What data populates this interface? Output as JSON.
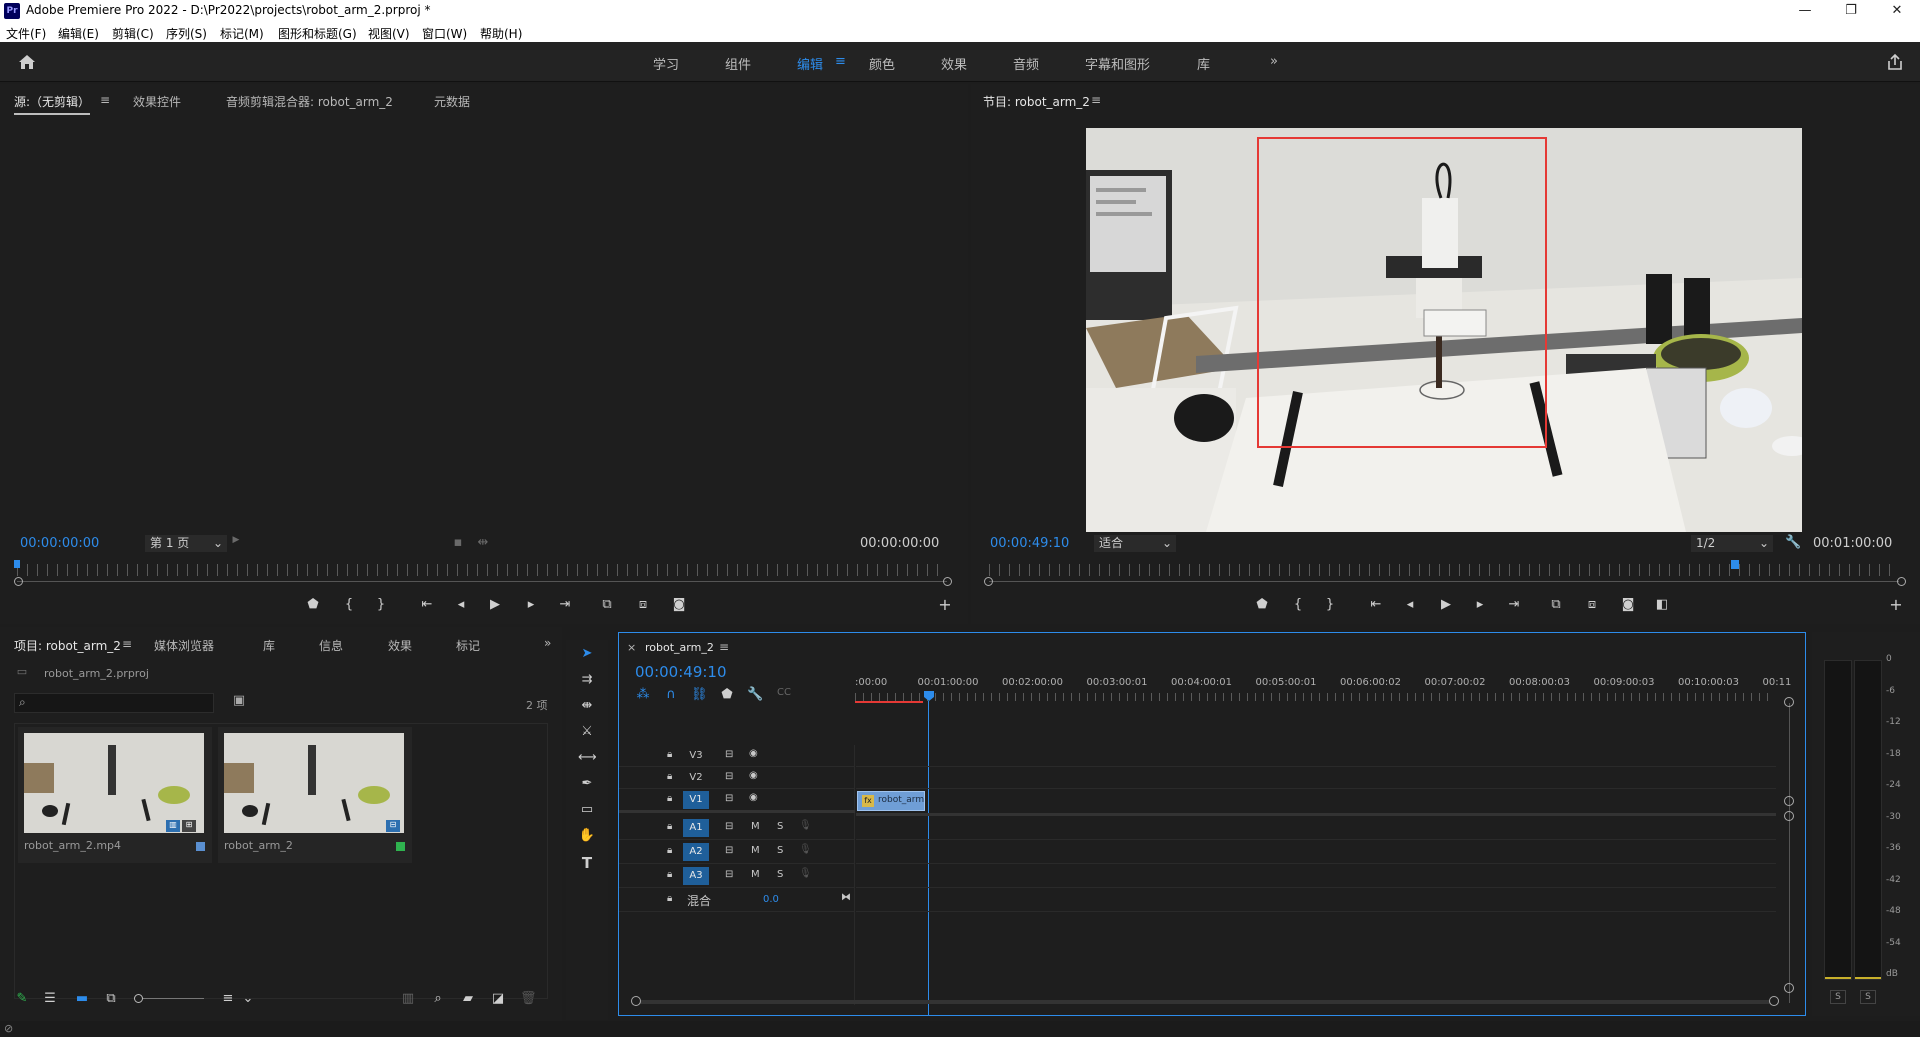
{
  "window": {
    "app_icon": "Pr",
    "title": "Adobe Premiere Pro 2022 - D:\\Pr2022\\projects\\robot_arm_2.prproj *",
    "minimize": "—",
    "restore": "❐",
    "close": "✕"
  },
  "menu": [
    "文件(F)",
    "编辑(E)",
    "剪辑(C)",
    "序列(S)",
    "标记(M)",
    "图形和标题(G)",
    "视图(V)",
    "窗口(W)",
    "帮助(H)"
  ],
  "workspaces": {
    "items": [
      "学习",
      "组件",
      "编辑",
      "颜色",
      "效果",
      "音频",
      "字幕和图形",
      "库"
    ],
    "active_index": 2,
    "more": "»"
  },
  "source_panel": {
    "tabs": [
      "源:（无剪辑）",
      "效果控件",
      "音频剪辑混合器: robot_arm_2",
      "元数据"
    ],
    "timecode_left": "00:00:00:00",
    "page_select": "第 1 页",
    "timecode_right": "00:00:00:00"
  },
  "program_panel": {
    "tab": "节目: robot_arm_2",
    "timecode": "00:00:49:10",
    "fit": "适合",
    "resolution": "1/2",
    "duration": "00:01:00:00",
    "playhead_fraction": 0.82
  },
  "project_panel": {
    "tabs": [
      "项目: robot_arm_2",
      "媒体浏览器",
      "库",
      "信息",
      "效果",
      "标记"
    ],
    "file": "robot_arm_2.prproj",
    "count": "2 项",
    "items": [
      {
        "name": "robot_arm_2.mp4",
        "tag_color": "#5a8fd0"
      },
      {
        "name": "robot_arm_2",
        "tag_color": "#2fb34f"
      }
    ]
  },
  "timeline": {
    "tab": "robot_arm_2",
    "timecode": "00:00:49:10",
    "ruler": [
      ":00:00",
      "00:01:00:00",
      "00:02:00:00",
      "00:03:00:01",
      "00:04:00:01",
      "00:05:00:01",
      "00:06:00:02",
      "00:07:00:02",
      "00:08:00:03",
      "00:09:00:03",
      "00:10:00:03",
      "00:11"
    ],
    "video_tracks": [
      {
        "label": "V3",
        "active": false
      },
      {
        "label": "V2",
        "active": false
      },
      {
        "label": "V1",
        "active": true
      }
    ],
    "audio_tracks": [
      {
        "label": "A1",
        "m": "M",
        "s": "S"
      },
      {
        "label": "A2",
        "m": "M",
        "s": "S"
      },
      {
        "label": "A3",
        "m": "M",
        "s": "S"
      }
    ],
    "mix_label": "混合",
    "mix_value": "0.0",
    "clip_label": "robot_arm",
    "clip_fx": "fx"
  },
  "meter": {
    "ticks": [
      "0",
      "-6",
      "-12",
      "-18",
      "-24",
      "-30",
      "-36",
      "-42",
      "-48",
      "-54",
      "dB"
    ],
    "solo_left": "S",
    "solo_right": "S"
  },
  "colors": {
    "accent": "#2d8ceb",
    "overlay_box": "#e53935",
    "clip": "#6f9ed6"
  }
}
